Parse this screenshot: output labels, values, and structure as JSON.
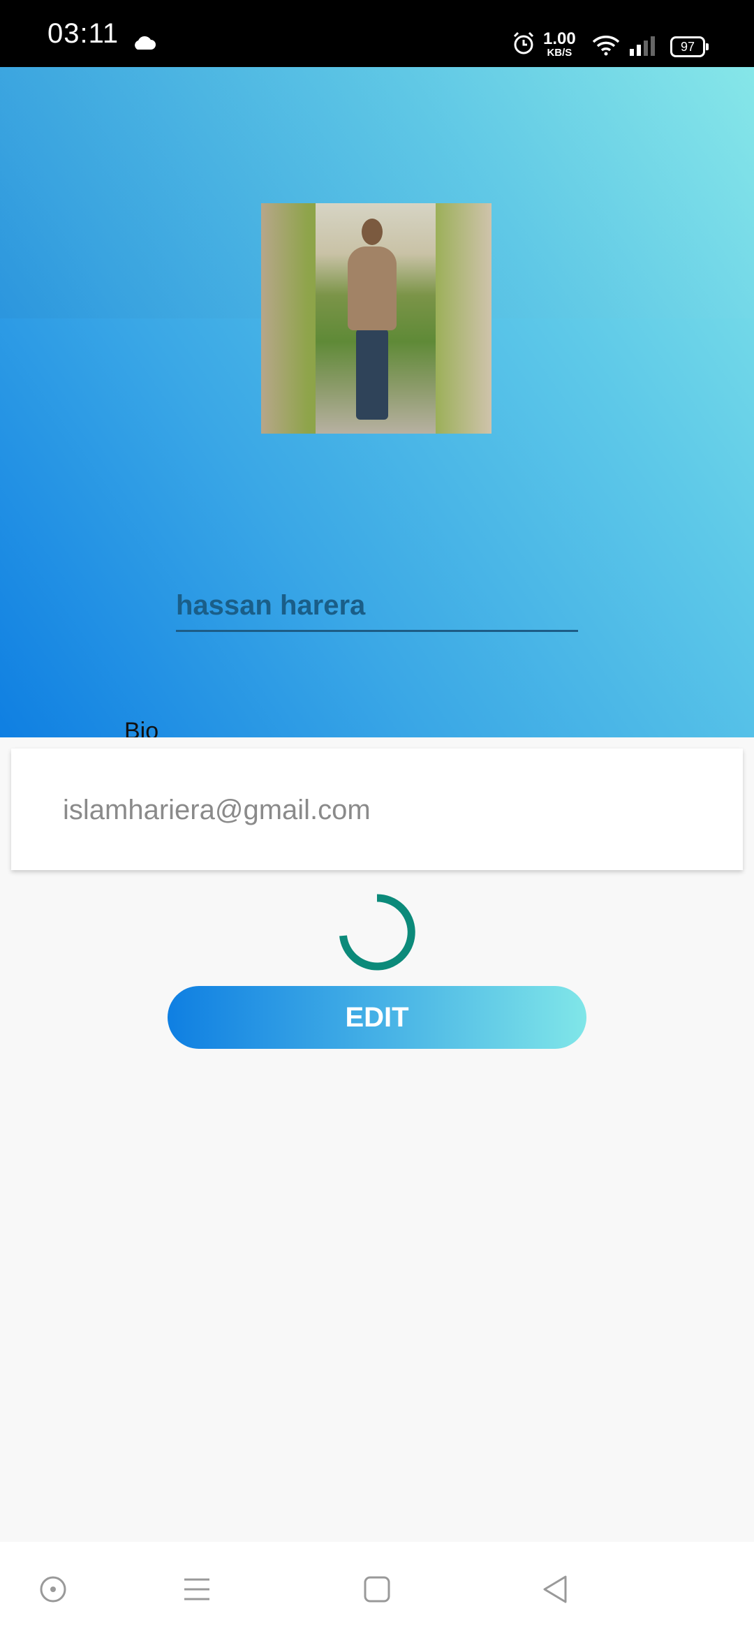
{
  "status_bar": {
    "time": "03:11",
    "net_speed_value": "1.00",
    "net_speed_unit": "KB/S",
    "battery": "97",
    "icons": [
      "cloud-icon",
      "alarm-icon",
      "wifi-icon",
      "signal-icon",
      "battery-icon"
    ]
  },
  "profile": {
    "name": "hassan harera",
    "bio_placeholder": "Bio",
    "email": "islamhariera@gmail.com"
  },
  "actions": {
    "edit_label": "EDIT"
  },
  "nav_bar": {
    "icons": [
      "assistant-icon",
      "menu-icon",
      "home-icon",
      "back-icon"
    ]
  },
  "colors": {
    "gradient_start": "#0f7fe2",
    "gradient_end": "#84e6e8",
    "spinner": "#0c8a7a",
    "field_underline": "#1d5c86",
    "name_text": "#1a5e88"
  }
}
